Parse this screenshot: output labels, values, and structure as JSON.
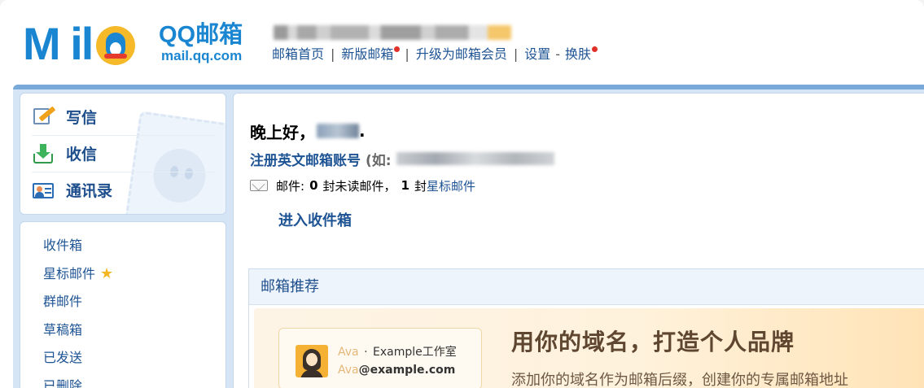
{
  "header": {
    "logo_text": "M il",
    "logo_brand": "QQ邮箱",
    "logo_domain": "mail.qq.com",
    "nav": [
      "邮箱首页",
      "新版邮箱",
      "升级为邮箱会员",
      "设置",
      "换肤"
    ]
  },
  "sidebar": {
    "actions": [
      "写信",
      "收信",
      "通讯录"
    ],
    "folders": [
      "收件箱",
      "星标邮件",
      "群邮件",
      "草稿箱",
      "已发送",
      "已删除"
    ]
  },
  "main": {
    "greeting": "晚上好，",
    "register_link": "注册英文邮箱账号",
    "register_hint": "(如:",
    "mail_label": "邮件:",
    "unread_count": "0",
    "unread_text": "封未读邮件，",
    "starred_count": "1",
    "starred_text": "封",
    "starred_link": "星标邮件",
    "enter_inbox": "进入收件箱",
    "recommend_title": "邮箱推荐",
    "banner": {
      "card_user": "Ava",
      "card_dot": "·",
      "card_brand": "Example工作室",
      "card_user2": "Ava",
      "card_address": "@example.com",
      "headline": "用你的域名，打造个人品牌",
      "subline": "添加你的域名作为邮箱后缀，创建你的专属邮箱地址"
    }
  }
}
